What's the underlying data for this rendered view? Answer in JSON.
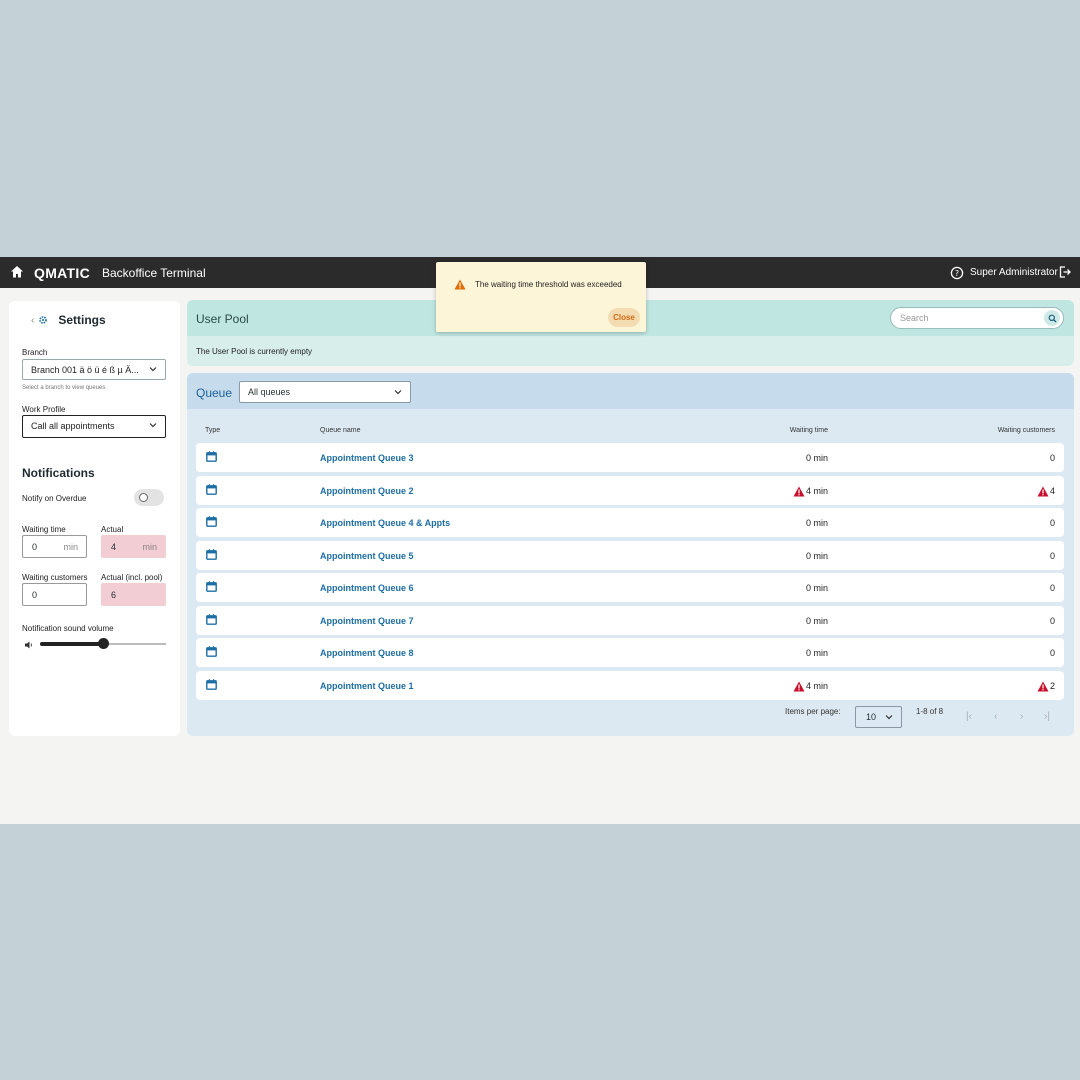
{
  "header": {
    "logo": "QMATIC",
    "app_title": "Backoffice Terminal",
    "user": "Super Administrator"
  },
  "sidebar": {
    "title": "Settings",
    "branch_label": "Branch",
    "branch_value": "Branch 001 ä ö ü é ß µ Ä...",
    "branch_hint": "Select a branch to view queues",
    "work_profile_label": "Work Profile",
    "work_profile_value": "Call all appointments",
    "notifications_title": "Notifications",
    "notify_overdue_label": "Notify on Overdue",
    "notify_overdue_on": false,
    "waiting_time_label": "Waiting time",
    "waiting_time_value": "0",
    "actual_label": "Actual",
    "actual_value": "4",
    "unit_min": "min",
    "waiting_customers_label": "Waiting customers",
    "waiting_customers_value": "0",
    "actual_pool_label": "Actual (incl. pool)",
    "actual_pool_value": "6",
    "volume_label": "Notification sound volume",
    "volume_level": 0.5
  },
  "pool": {
    "title": "User Pool",
    "search_placeholder": "Search",
    "empty_message": "The User Pool is currently empty"
  },
  "queue": {
    "title": "Queue",
    "filter_value": "All queues",
    "columns": {
      "type": "Type",
      "name": "Queue name",
      "waiting_time": "Waiting time",
      "waiting_customers": "Waiting customers"
    },
    "rows": [
      {
        "name": "Appointment Queue 3",
        "waiting_time": "0 min",
        "waiting_customers": "0",
        "warn": false
      },
      {
        "name": "Appointment Queue 2",
        "waiting_time": "4 min",
        "waiting_customers": "4",
        "warn": true
      },
      {
        "name": "Appointment Queue 4 & Appts",
        "waiting_time": "0 min",
        "waiting_customers": "0",
        "warn": false
      },
      {
        "name": "Appointment Queue 5",
        "waiting_time": "0 min",
        "waiting_customers": "0",
        "warn": false
      },
      {
        "name": "Appointment Queue 6",
        "waiting_time": "0 min",
        "waiting_customers": "0",
        "warn": false
      },
      {
        "name": "Appointment Queue 7",
        "waiting_time": "0 min",
        "waiting_customers": "0",
        "warn": false
      },
      {
        "name": "Appointment Queue 8",
        "waiting_time": "0 min",
        "waiting_customers": "0",
        "warn": false
      },
      {
        "name": "Appointment Queue 1",
        "waiting_time": "4 min",
        "waiting_customers": "2",
        "warn": true
      }
    ],
    "items_per_page_label": "Items per page:",
    "items_per_page": "10",
    "range": "1-8 of 8"
  },
  "toast": {
    "message": "The waiting time threshold was exceeded",
    "close_label": "Close"
  },
  "colors": {
    "accent": "#1c6ea4",
    "warning": "#c8102e",
    "toast_warning": "#e06c00"
  }
}
